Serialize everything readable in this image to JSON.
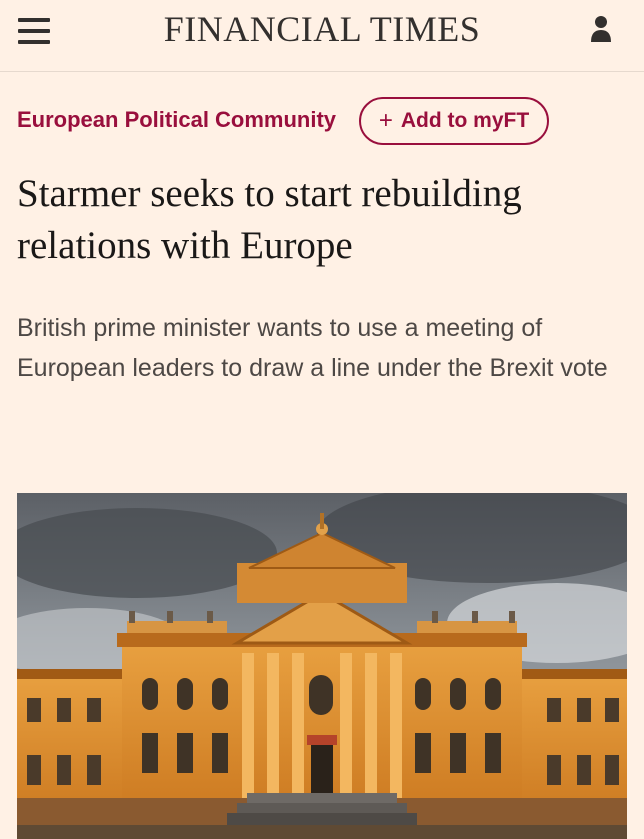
{
  "header": {
    "masthead": "FINANCIAL TIMES",
    "menu_icon": "hamburger-menu-icon",
    "account_icon": "user-icon"
  },
  "article": {
    "topic": "European Political Community",
    "follow_button": {
      "icon": "plus-icon",
      "label": "Add to myFT"
    },
    "headline": "Starmer seeks to start rebuilding relations with Europe",
    "standfirst": "British prime minister wants to use a meeting of European leaders to draw a line under the Brexit vote"
  },
  "colors": {
    "background": "#fff1e5",
    "accent": "#990f3d",
    "text": "#33302e"
  }
}
